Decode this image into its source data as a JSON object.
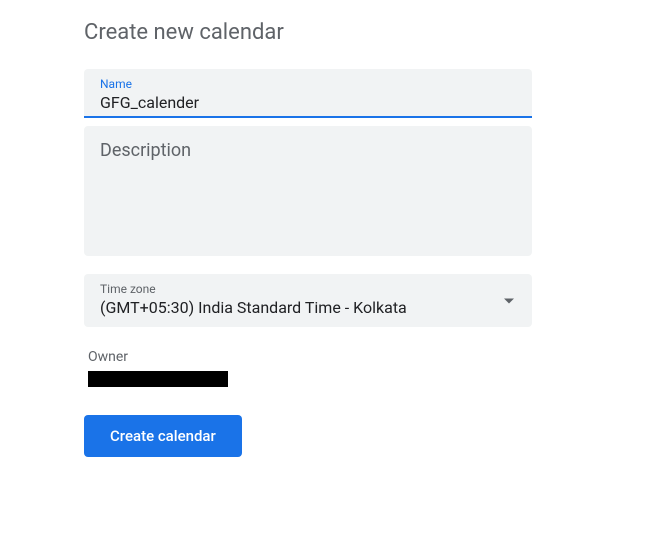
{
  "page": {
    "title": "Create new calendar"
  },
  "form": {
    "name": {
      "label": "Name",
      "value": "GFG_calender"
    },
    "description": {
      "label": "Description",
      "value": ""
    },
    "timezone": {
      "label": "Time zone",
      "value": "(GMT+05:30) India Standard Time - Kolkata"
    },
    "owner": {
      "label": "Owner",
      "value": "████████████"
    },
    "submit": {
      "label": "Create calendar"
    }
  }
}
